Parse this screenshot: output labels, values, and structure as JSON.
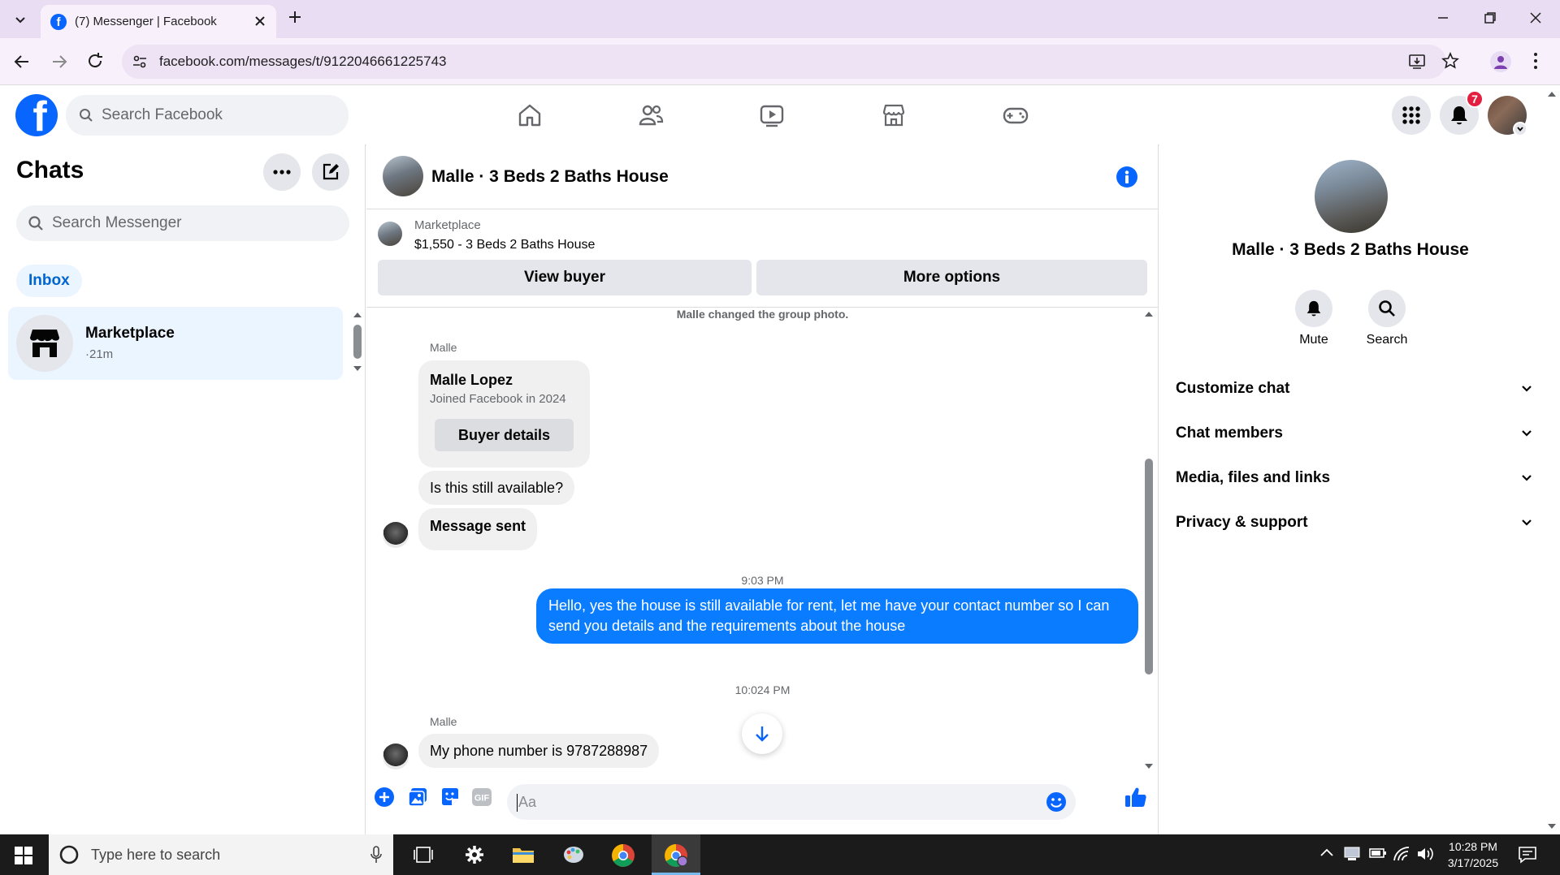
{
  "browser": {
    "tab_title": "(7) Messenger | Facebook",
    "url": "facebook.com/messages/t/9122046661225743"
  },
  "fb_header": {
    "search_placeholder": "Search Facebook",
    "notification_count": "7"
  },
  "chats": {
    "title": "Chats",
    "search_placeholder": "Search Messenger",
    "filter_inbox": "Inbox",
    "items": [
      {
        "name": "Marketplace",
        "meta": "·21m"
      }
    ]
  },
  "conversation": {
    "title": "Malle · 3 Beds 2 Baths House",
    "listing": {
      "source": "Marketplace",
      "summary": "$1,550 - 3 Beds 2 Baths House",
      "view_buyer_label": "View buyer",
      "more_options_label": "More options"
    },
    "system_note": "Malle changed the group photo.",
    "sender_label_1": "Malle",
    "profile_card": {
      "name": "Malle Lopez",
      "joined": "Joined Facebook in 2024",
      "button_label": "Buyer details"
    },
    "msg_question": "Is this still available?",
    "msg_sent": "Message sent",
    "ts_1": "9:03 PM",
    "msg_me": "Hello, yes the house is still available for rent, let me have your contact number so I can send you details and the requirements about the house",
    "ts_2": "10:024 PM",
    "sender_label_2": "Malle",
    "msg_phone": "My phone number is 9787288987",
    "composer_placeholder": "Aa"
  },
  "details": {
    "title": "Malle · 3 Beds 2 Baths House",
    "mute_label": "Mute",
    "search_label": "Search",
    "sections": [
      "Customize chat",
      "Chat members",
      "Media, files and links",
      "Privacy & support"
    ]
  },
  "taskbar": {
    "search_placeholder": "Type here to search",
    "time": "10:28 PM",
    "date": "3/17/2025"
  },
  "colors": {
    "fb_blue": "#0866ff",
    "bubble_blue": "#0a7cff",
    "badge_red": "#e41e3f"
  }
}
